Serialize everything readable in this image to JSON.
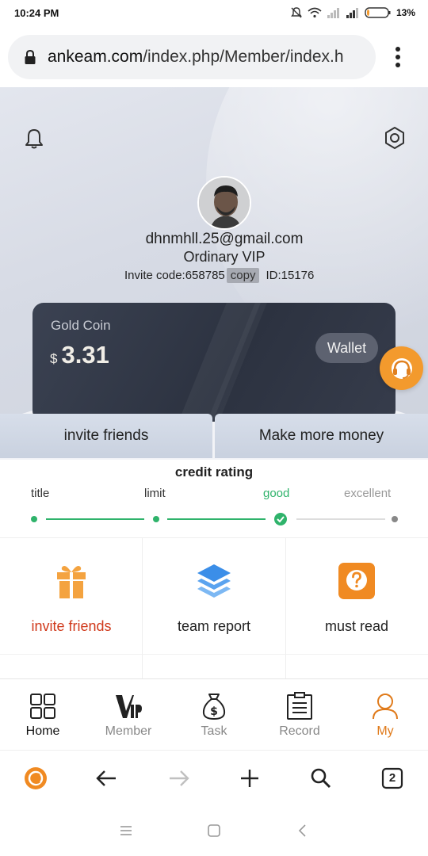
{
  "status_bar": {
    "time": "10:24 PM",
    "battery_pct": "13%",
    "battery_level": 0.13
  },
  "browser": {
    "url_host": "ankeam.com",
    "url_path": "/index.php/Member/index.h",
    "tab_count": "2"
  },
  "profile": {
    "email": "dhnmhll.25@gmail.com",
    "level": "Ordinary VIP",
    "invite_label": "Invite code:",
    "invite_code": "658785",
    "copy_label": "copy",
    "id_label": "ID:",
    "id_value": "15176"
  },
  "card": {
    "title": "Gold Coin",
    "currency": "$",
    "amount": "3.31",
    "wallet_label": "Wallet"
  },
  "actions": {
    "left": "invite friends",
    "right": "Make more money"
  },
  "credit": {
    "title": "credit rating",
    "levels": [
      "title",
      "limit",
      "good",
      "excellent"
    ],
    "current_level": "good",
    "colors": {
      "active": "#2fb36b",
      "inactive": "#bbbbbb"
    }
  },
  "features": [
    {
      "label": "invite friends",
      "icon": "gift-icon"
    },
    {
      "label": "team report",
      "icon": "layers-icon"
    },
    {
      "label": "must read",
      "icon": "question-icon"
    }
  ],
  "nav": {
    "items": [
      {
        "label": "Home",
        "icon": "grid-icon"
      },
      {
        "label": "Member",
        "icon": "vip-icon"
      },
      {
        "label": "Task",
        "icon": "money-bag-icon"
      },
      {
        "label": "Record",
        "icon": "clipboard-icon"
      },
      {
        "label": "My",
        "icon": "user-icon"
      }
    ],
    "active": "My"
  },
  "colors": {
    "accent_orange": "#f39a2d",
    "active_nav": "#e07a1a",
    "invite_red": "#d0391b",
    "card_bg": "#2c3240",
    "credit_green": "#2fb36b"
  }
}
